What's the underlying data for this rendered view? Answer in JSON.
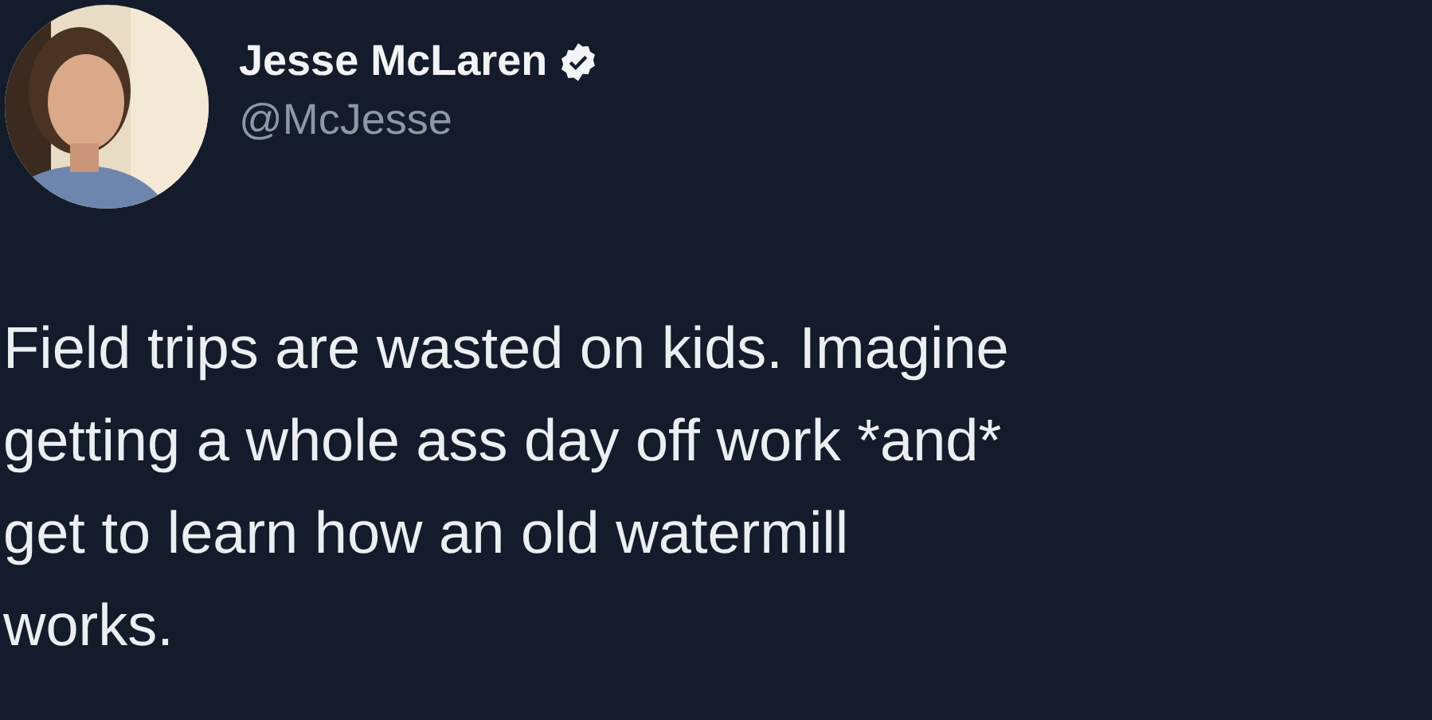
{
  "author": {
    "name": "Jesse McLaren",
    "handle": "@McJesse",
    "verified": true
  },
  "tweet": {
    "lines": [
      "Field trips are wasted on kids. Imagine",
      "getting a whole ass day off work *and*",
      "get to learn how an old watermill",
      "works."
    ]
  }
}
